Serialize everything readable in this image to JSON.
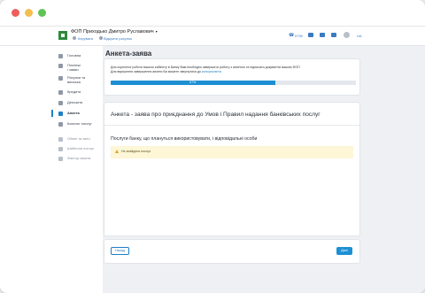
{
  "window": {
    "controls": [
      "close",
      "minimize",
      "maximize"
    ]
  },
  "header": {
    "company_name": "ФОП Приходько Дмитро Руславович",
    "company_caret": "▾",
    "sub_links": [
      "Керувати",
      "Відкрити рахунок"
    ],
    "phone_icon": "phone-icon",
    "phone_label": "0790",
    "icons": [
      "chat-icon",
      "bell-icon",
      "graduation-icon"
    ],
    "language": "UA"
  },
  "sidebar": {
    "items": [
      {
        "label": "Головна",
        "icon": "home-icon"
      },
      {
        "label": "Платежі\nі заяви",
        "icon": "payments-icon"
      },
      {
        "label": "Рахунки та\nвиписка",
        "icon": "accounts-icon"
      },
      {
        "label": "Кредити",
        "icon": "credit-icon"
      },
      {
        "label": "Депозити",
        "icon": "deposit-icon"
      },
      {
        "label": "Анкета",
        "icon": "form-icon",
        "active": true
      },
      {
        "label": "Каталог послуг",
        "icon": "catalog-icon"
      },
      {
        "label": "Обмін та авто",
        "icon": "exchange-icon",
        "muted": true
      },
      {
        "label": "Шаблони послуг",
        "icon": "template-icon",
        "muted": true
      },
      {
        "label": "Фактор-аналіз",
        "icon": "analysis-icon",
        "muted": true
      }
    ]
  },
  "main": {
    "page_title": "Анкета-заява",
    "info": {
      "text_line1": "Для коректної роботи вашого кабінету в Банку Вам необхідно завершити роботу з анкетою та підписати документи вашою ФОП",
      "text_line2": "Для вирішення завершення анкети Ви можете звернутися до ",
      "link_text": "консультанта",
      "progress_label": "67%",
      "progress_value": 0.67
    },
    "card_title": "Анкета - заява про приєднання до Умов і Правил надання банківських послуг",
    "section_title": "Послуги банку, що плануться використовувати, і відповідальні особи",
    "warning_text": "Не знайдено послуг"
  },
  "footer": {
    "back_label": "Назад",
    "next_label": "Далі"
  },
  "colors": {
    "accent": "#1d8fd3",
    "warning_bg": "#fdf6d7",
    "logo_green": "#2f8a3c"
  }
}
